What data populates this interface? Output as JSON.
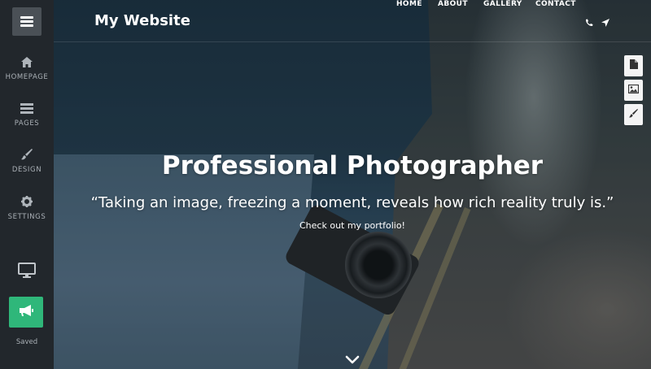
{
  "sidebar": {
    "menu_icon": "hamburger-icon",
    "items": [
      {
        "label": "HOMEPAGE",
        "icon": "home-icon"
      },
      {
        "label": "PAGES",
        "icon": "pages-icon"
      },
      {
        "label": "DESIGN",
        "icon": "brush-icon"
      },
      {
        "label": "SETTINGS",
        "icon": "gear-icon"
      }
    ],
    "preview_icon": "monitor-icon",
    "publish_icon": "megaphone-icon",
    "status": "Saved",
    "publish_color": "#2fb77a"
  },
  "site": {
    "title": "My Website",
    "nav": [
      "HOME",
      "ABOUT",
      "GALLERY",
      "CONTACT"
    ],
    "nav_icons": [
      "phone-icon",
      "location-arrow-icon"
    ]
  },
  "tools": [
    "page-icon",
    "image-icon",
    "brush-icon"
  ],
  "hero": {
    "headline": "Professional Photographer",
    "quote": "“Taking an image, freezing a moment, reveals how rich reality truly is.”",
    "link": "Check out my portfolio!",
    "scroll_icon": "chevron-down-icon"
  }
}
